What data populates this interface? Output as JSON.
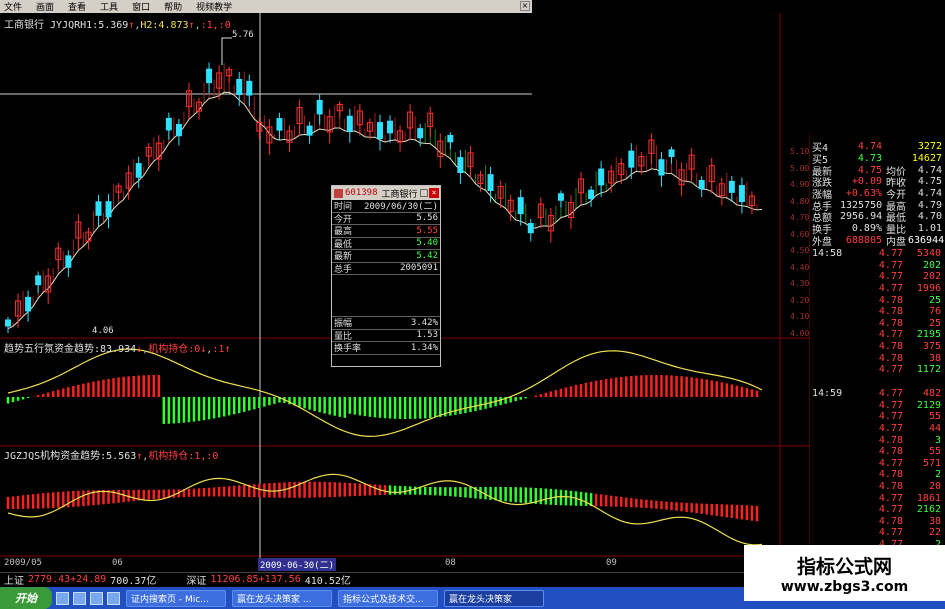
{
  "menu": [
    "文件",
    "画面",
    "查看",
    "工具",
    "窗口",
    "帮助",
    "视频教学"
  ],
  "main_panel": {
    "stock_name": "工商银行",
    "indicator": "JYJQRH1:5.369",
    "h2": "H2:4.873",
    "extra": ":1,:0",
    "peak_label": "5.76",
    "low_label": "4.06"
  },
  "panel2": {
    "title": "趋势五行氛资金趋势:83.934",
    "extra": "机构持仓:0",
    "extra2": ":1"
  },
  "panel3": {
    "title": "JGZJQS机构资金趋势:5.563",
    "extra": "机构持仓:1,:0"
  },
  "popup": {
    "code": "601398",
    "name": "工商银行",
    "rows": [
      {
        "k": "时间",
        "v": "2009/06/30(二)"
      },
      {
        "k": "今开",
        "v": "5.56"
      },
      {
        "k": "最高",
        "v": "5.55"
      },
      {
        "k": "最低",
        "v": "5.40"
      },
      {
        "k": "最新",
        "v": "5.42"
      },
      {
        "k": "总手",
        "v": "2005091"
      }
    ],
    "rows2": [
      {
        "k": "振幅",
        "v": "3.42%"
      },
      {
        "k": "量比",
        "v": "1.53"
      },
      {
        "k": "换手率",
        "v": "1.34%"
      }
    ]
  },
  "quote": {
    "rows": [
      {
        "a": "买4",
        "b": "4.74",
        "c": "",
        "d": "3272",
        "bc": "#ff4040",
        "dc": "#ffff00"
      },
      {
        "a": "买5",
        "b": "4.73",
        "c": "",
        "d": "14627",
        "bc": "#40ff40",
        "dc": "#ffff00"
      },
      {
        "a": "最新",
        "b": "4.75",
        "c": "均价",
        "d": "4.74",
        "bc": "#ff4040",
        "dc": "#e0e0e0"
      },
      {
        "a": "涨跌",
        "b": "+0.09",
        "c": "昨收",
        "d": "4.75",
        "bc": "#ff4040",
        "dc": "#e0e0e0"
      },
      {
        "a": "涨幅",
        "b": "+0.63%",
        "c": "今开",
        "d": "4.74",
        "bc": "#ff4040",
        "dc": "#e0e0e0"
      },
      {
        "a": "总手",
        "b": "1325750",
        "c": "最高",
        "d": "4.79",
        "bc": "#e0e0e0",
        "dc": "#e0e0e0"
      },
      {
        "a": "总额",
        "b": "2956.94",
        "c": "最低",
        "d": "4.70",
        "bc": "#e0e0e0",
        "dc": "#e0e0e0"
      },
      {
        "a": "换手",
        "b": "0.89%",
        "c": "量比",
        "d": "1.01",
        "bc": "#e0e0e0",
        "dc": "#e0e0e0"
      },
      {
        "a": "外盘",
        "b": "688805",
        "c": "内盘",
        "d": "636944",
        "bc": "#ff4040",
        "dc": "#ffffff"
      }
    ]
  },
  "ticks1": {
    "time": "14:58",
    "rows": [
      {
        "p": "4.77",
        "v": "5340"
      },
      {
        "p": "4.77",
        "v": "202"
      },
      {
        "p": "4.77",
        "v": "202"
      },
      {
        "p": "4.77",
        "v": "1996"
      },
      {
        "p": "4.78",
        "v": "25"
      },
      {
        "p": "4.78",
        "v": "76"
      },
      {
        "p": "4.78",
        "v": "25"
      },
      {
        "p": "4.77",
        "v": "2195"
      },
      {
        "p": "4.78",
        "v": "375"
      },
      {
        "p": "4.78",
        "v": "38"
      },
      {
        "p": "4.77",
        "v": "1172"
      }
    ]
  },
  "ticks2": {
    "time": "14:59",
    "rows": [
      {
        "p": "4.77",
        "v": "482"
      },
      {
        "p": "4.77",
        "v": "2129"
      },
      {
        "p": "4.77",
        "v": "55"
      },
      {
        "p": "4.77",
        "v": "44"
      },
      {
        "p": "4.78",
        "v": "3"
      },
      {
        "p": "4.78",
        "v": "55"
      },
      {
        "p": "4.77",
        "v": "571"
      },
      {
        "p": "4.78",
        "v": "2"
      },
      {
        "p": "4.78",
        "v": "20"
      },
      {
        "p": "4.77",
        "v": "1861"
      },
      {
        "p": "4.77",
        "v": "2162"
      },
      {
        "p": "4.78",
        "v": "38"
      },
      {
        "p": "4.77",
        "v": "22"
      },
      {
        "p": "4.77",
        "v": "2"
      }
    ]
  },
  "scale": [
    "5.10",
    "5.00",
    "4.90",
    "4.80",
    "4.70",
    "4.60",
    "4.50",
    "4.40",
    "4.30",
    "4.20",
    "4.10",
    "4.00"
  ],
  "dates": [
    "2009/05",
    "06",
    "2009-06-30(二)",
    "08",
    "09"
  ],
  "status": {
    "sh_label": "上证",
    "sh_value": "2779.43",
    "sh_change": "+24.89",
    "sh_amount": "700.37亿",
    "sz_label": "深证",
    "sz_value": "11206.85",
    "sz_change": "+137.56",
    "sz_amount": "410.52亿"
  },
  "taskbar": {
    "start": "开始",
    "buttons": [
      "证内搜索页 - Mic...",
      "赢在龙头决策家 ...",
      "指标公式及技术交...",
      "赢在龙头决策家"
    ]
  },
  "watermark": {
    "line1": "指标公式网",
    "line2": "www.zbgs3.com"
  }
}
